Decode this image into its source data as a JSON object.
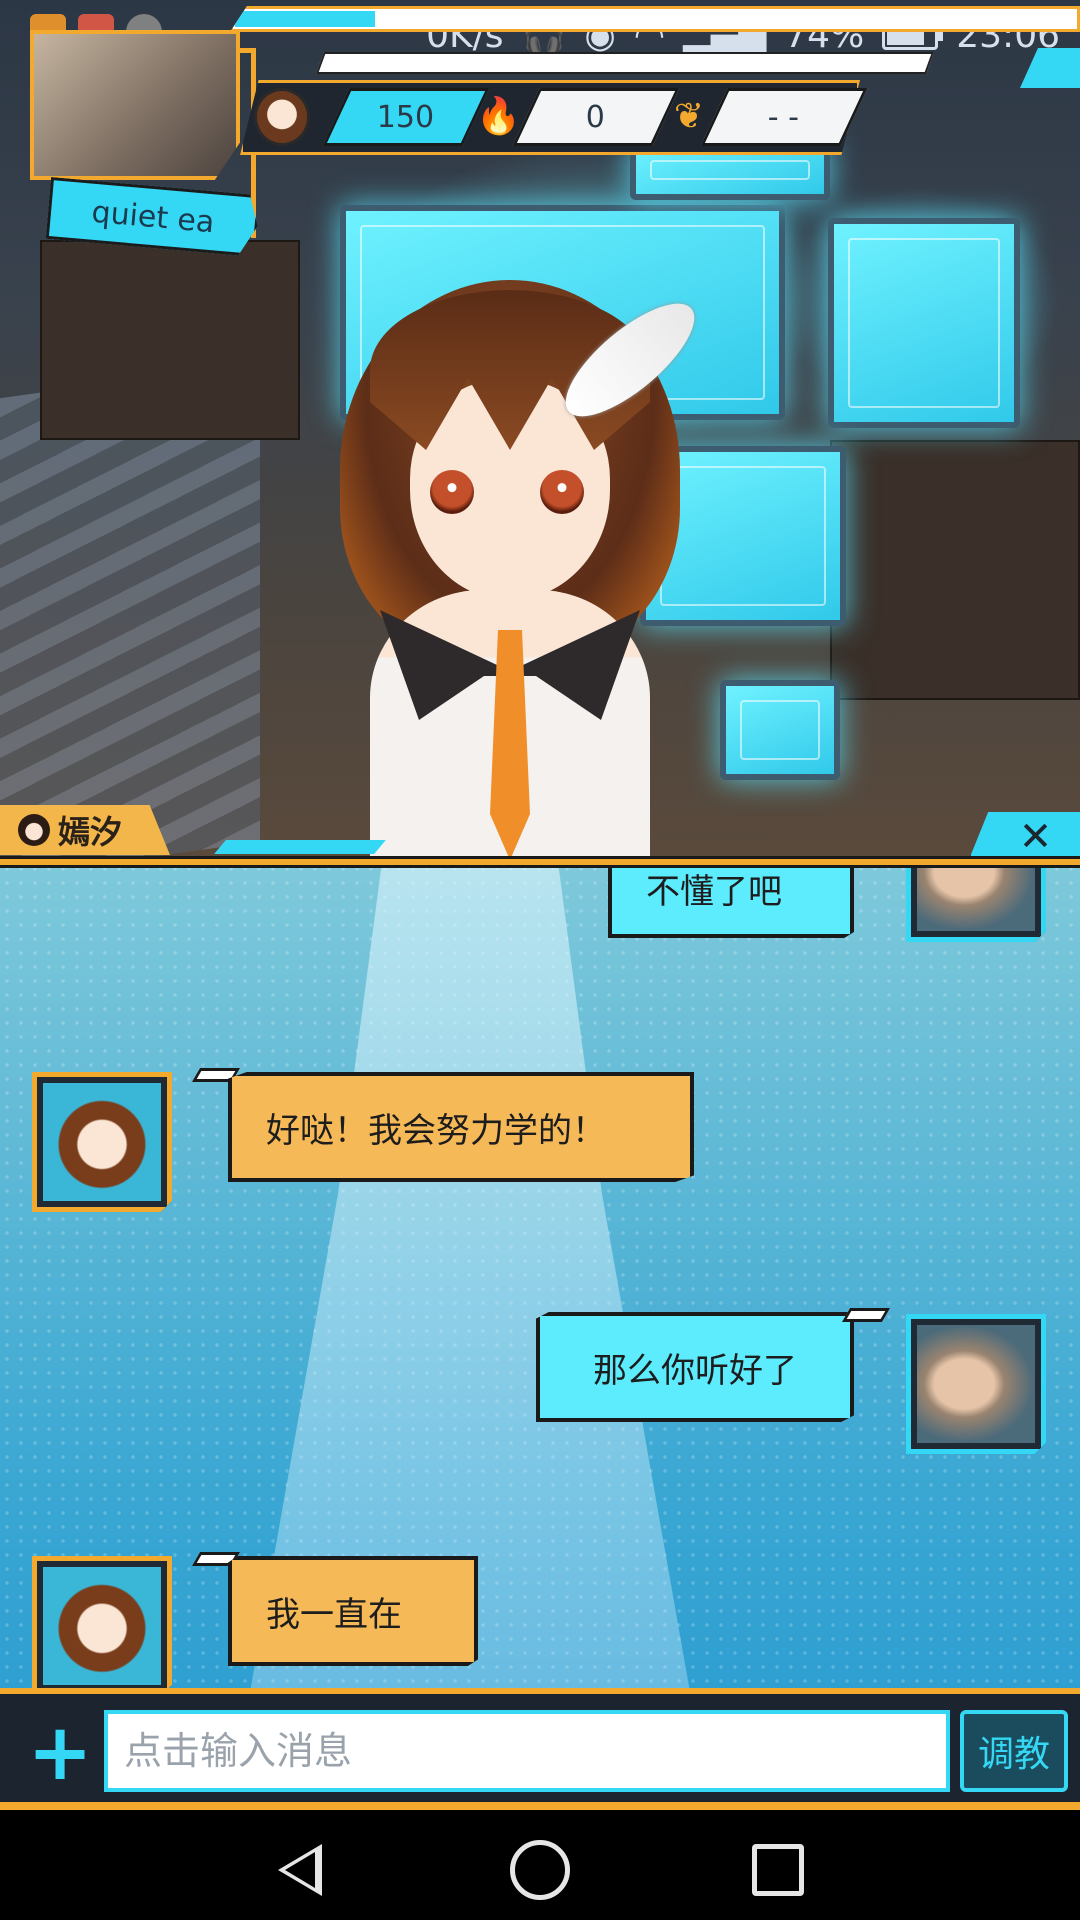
{
  "status_bar": {
    "network_speed": "0K/s",
    "battery_percent": "74%",
    "time": "23:06"
  },
  "profile": {
    "name": "quiet ea"
  },
  "stats": {
    "hearts": "150",
    "flames": "0",
    "wings": "- -"
  },
  "character": {
    "name": "嫣汐"
  },
  "chat": {
    "messages": [
      {
        "sender": "user",
        "text": "不懂了吧"
      },
      {
        "sender": "character",
        "text": "好哒！我会努力学的！"
      },
      {
        "sender": "user",
        "text": "那么你听好了"
      },
      {
        "sender": "character",
        "text": "我一直在"
      }
    ]
  },
  "input": {
    "placeholder": "点击输入消息",
    "train_label": "调教"
  },
  "close_label": "✕",
  "colors": {
    "accent_orange": "#f3a92d",
    "accent_cyan": "#34d8f4",
    "bubble_orange": "#f6b957",
    "bubble_cyan": "#5cecfd"
  }
}
